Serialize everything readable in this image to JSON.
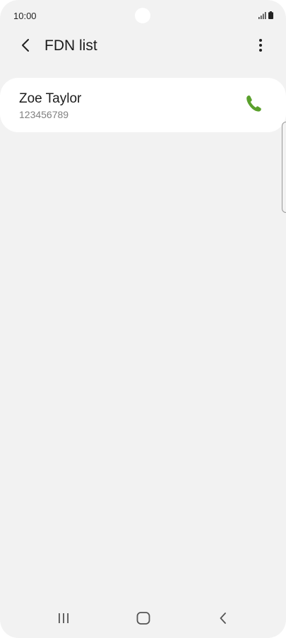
{
  "status_bar": {
    "time": "10:00",
    "signal_icon": "signal-icon",
    "battery_icon": "battery-icon"
  },
  "app_bar": {
    "title": "FDN list",
    "back_icon": "chevron-left-icon",
    "more_icon": "more-vertical-icon"
  },
  "contacts": [
    {
      "name": "Zoe Taylor",
      "number": "123456789",
      "action_icon": "phone-icon"
    }
  ],
  "colors": {
    "background": "#f2f2f2",
    "card": "#ffffff",
    "call_accent": "#5aa02c"
  },
  "nav_bar": {
    "recents_icon": "recents-icon",
    "home_icon": "home-icon",
    "back_icon": "back-icon"
  }
}
